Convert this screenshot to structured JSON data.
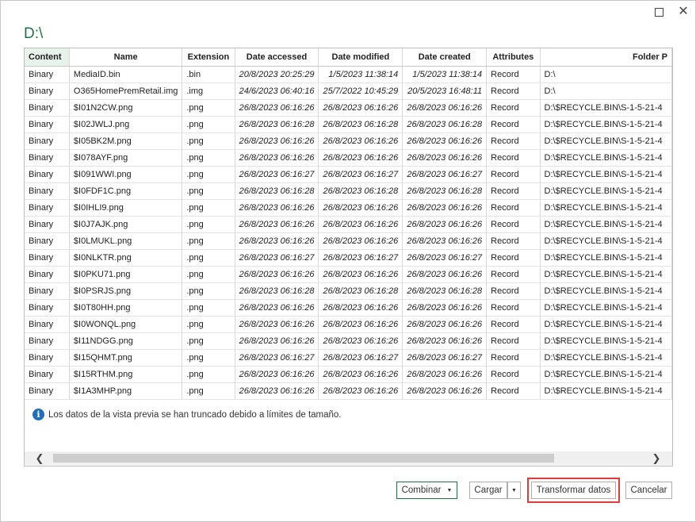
{
  "window": {
    "maximize_icon": "maximize-icon",
    "close_icon": "close-icon",
    "close_glyph": "✕"
  },
  "path_title": "D:\\",
  "table": {
    "headers": [
      "Content",
      "Name",
      "Extension",
      "Date accessed",
      "Date modified",
      "Date created",
      "Attributes",
      "Folder P"
    ],
    "rows": [
      [
        "Binary",
        "MediaID.bin",
        ".bin",
        "20/8/2023 20:25:29",
        "1/5/2023 11:38:14",
        "1/5/2023 11:38:14",
        "Record",
        "D:\\"
      ],
      [
        "Binary",
        "O365HomePremRetail.img",
        ".img",
        "24/6/2023 06:40:16",
        "25/7/2022 10:45:29",
        "20/5/2023 16:48:11",
        "Record",
        "D:\\"
      ],
      [
        "Binary",
        "$I01N2CW.png",
        ".png",
        "26/8/2023 06:16:26",
        "26/8/2023 06:16:26",
        "26/8/2023 06:16:26",
        "Record",
        "D:\\$RECYCLE.BIN\\S-1-5-21-4"
      ],
      [
        "Binary",
        "$I02JWLJ.png",
        ".png",
        "26/8/2023 06:16:28",
        "26/8/2023 06:16:28",
        "26/8/2023 06:16:28",
        "Record",
        "D:\\$RECYCLE.BIN\\S-1-5-21-4"
      ],
      [
        "Binary",
        "$I05BK2M.png",
        ".png",
        "26/8/2023 06:16:26",
        "26/8/2023 06:16:26",
        "26/8/2023 06:16:26",
        "Record",
        "D:\\$RECYCLE.BIN\\S-1-5-21-4"
      ],
      [
        "Binary",
        "$I078AYF.png",
        ".png",
        "26/8/2023 06:16:26",
        "26/8/2023 06:16:26",
        "26/8/2023 06:16:26",
        "Record",
        "D:\\$RECYCLE.BIN\\S-1-5-21-4"
      ],
      [
        "Binary",
        "$I091WWI.png",
        ".png",
        "26/8/2023 06:16:27",
        "26/8/2023 06:16:27",
        "26/8/2023 06:16:27",
        "Record",
        "D:\\$RECYCLE.BIN\\S-1-5-21-4"
      ],
      [
        "Binary",
        "$I0FDF1C.png",
        ".png",
        "26/8/2023 06:16:28",
        "26/8/2023 06:16:28",
        "26/8/2023 06:16:28",
        "Record",
        "D:\\$RECYCLE.BIN\\S-1-5-21-4"
      ],
      [
        "Binary",
        "$I0IHLI9.png",
        ".png",
        "26/8/2023 06:16:26",
        "26/8/2023 06:16:26",
        "26/8/2023 06:16:26",
        "Record",
        "D:\\$RECYCLE.BIN\\S-1-5-21-4"
      ],
      [
        "Binary",
        "$I0J7AJK.png",
        ".png",
        "26/8/2023 06:16:26",
        "26/8/2023 06:16:26",
        "26/8/2023 06:16:26",
        "Record",
        "D:\\$RECYCLE.BIN\\S-1-5-21-4"
      ],
      [
        "Binary",
        "$I0LMUKL.png",
        ".png",
        "26/8/2023 06:16:26",
        "26/8/2023 06:16:26",
        "26/8/2023 06:16:26",
        "Record",
        "D:\\$RECYCLE.BIN\\S-1-5-21-4"
      ],
      [
        "Binary",
        "$I0NLKTR.png",
        ".png",
        "26/8/2023 06:16:27",
        "26/8/2023 06:16:27",
        "26/8/2023 06:16:27",
        "Record",
        "D:\\$RECYCLE.BIN\\S-1-5-21-4"
      ],
      [
        "Binary",
        "$I0PKU71.png",
        ".png",
        "26/8/2023 06:16:26",
        "26/8/2023 06:16:26",
        "26/8/2023 06:16:26",
        "Record",
        "D:\\$RECYCLE.BIN\\S-1-5-21-4"
      ],
      [
        "Binary",
        "$I0PSRJS.png",
        ".png",
        "26/8/2023 06:16:28",
        "26/8/2023 06:16:28",
        "26/8/2023 06:16:28",
        "Record",
        "D:\\$RECYCLE.BIN\\S-1-5-21-4"
      ],
      [
        "Binary",
        "$I0T80HH.png",
        ".png",
        "26/8/2023 06:16:26",
        "26/8/2023 06:16:26",
        "26/8/2023 06:16:26",
        "Record",
        "D:\\$RECYCLE.BIN\\S-1-5-21-4"
      ],
      [
        "Binary",
        "$I0WONQL.png",
        ".png",
        "26/8/2023 06:16:26",
        "26/8/2023 06:16:26",
        "26/8/2023 06:16:26",
        "Record",
        "D:\\$RECYCLE.BIN\\S-1-5-21-4"
      ],
      [
        "Binary",
        "$I11NDGG.png",
        ".png",
        "26/8/2023 06:16:26",
        "26/8/2023 06:16:26",
        "26/8/2023 06:16:26",
        "Record",
        "D:\\$RECYCLE.BIN\\S-1-5-21-4"
      ],
      [
        "Binary",
        "$I15QHMT.png",
        ".png",
        "26/8/2023 06:16:27",
        "26/8/2023 06:16:27",
        "26/8/2023 06:16:27",
        "Record",
        "D:\\$RECYCLE.BIN\\S-1-5-21-4"
      ],
      [
        "Binary",
        "$I15RTHM.png",
        ".png",
        "26/8/2023 06:16:26",
        "26/8/2023 06:16:26",
        "26/8/2023 06:16:26",
        "Record",
        "D:\\$RECYCLE.BIN\\S-1-5-21-4"
      ],
      [
        "Binary",
        "$I1A3MHP.png",
        ".png",
        "26/8/2023 06:16:26",
        "26/8/2023 06:16:26",
        "26/8/2023 06:16:26",
        "Record",
        "D:\\$RECYCLE.BIN\\S-1-5-21-4"
      ]
    ]
  },
  "notice": {
    "icon": "info-icon",
    "glyph": "i",
    "text": "Los datos de la vista previa se han truncado debido a límites de tamaño."
  },
  "scrollbar": {
    "left_glyph": "❮",
    "right_glyph": "❯"
  },
  "buttons": {
    "combinar": "Combinar",
    "combinar_caret": "▼",
    "cargar": "Cargar",
    "cargar_caret": "▼",
    "transformar": "Transformar datos",
    "cancelar": "Cancelar"
  },
  "colors": {
    "accent": "#217346",
    "highlight": "#e03c3c",
    "info": "#1e6fb8"
  }
}
